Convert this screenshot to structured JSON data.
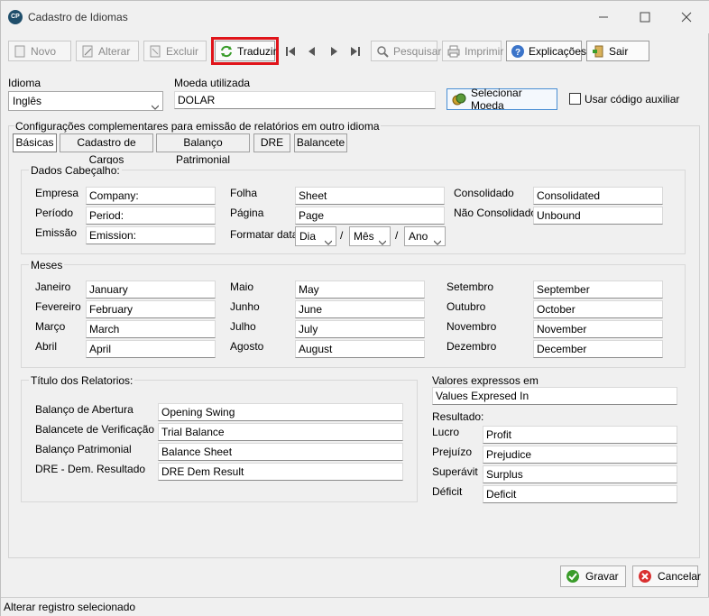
{
  "window": {
    "title": "Cadastro de Idiomas",
    "icon_text": "CP"
  },
  "toolbar": {
    "novo": "Novo",
    "alterar": "Alterar",
    "excluir": "Excluir",
    "traduzir": "Traduzir",
    "pesquisar": "Pesquisar",
    "imprimir": "Imprimir",
    "explicacoes": "Explicações",
    "sair": "Sair"
  },
  "form": {
    "idioma_label": "Idioma",
    "idioma_value": "Inglês",
    "moeda_label": "Moeda utilizada",
    "moeda_value": "DOLAR",
    "selecionar_moeda": "Selecionar Moeda",
    "usar_codigo": "Usar código auxiliar"
  },
  "config_title": "Configurações complementares para emissão de relatórios em outro idioma",
  "tabs": [
    "Básicas",
    "Cadastro de Cargos",
    "Balanço Patrimonial",
    "DRE",
    "Balancete"
  ],
  "cabecalho": {
    "title": "Dados Cabeçalho:",
    "empresa_label": "Empresa",
    "empresa_value": "Company:",
    "periodo_label": "Período",
    "periodo_value": "Period:",
    "emissao_label": "Emissão",
    "emissao_value": "Emission:",
    "folha_label": "Folha",
    "folha_value": "Sheet",
    "pagina_label": "Página",
    "pagina_value": "Page",
    "formatar_label": "Formatar data",
    "dia": "Dia",
    "mes": "Mês",
    "ano": "Ano",
    "sep": "/",
    "consolidado_label": "Consolidado",
    "consolidado_value": "Consolidated",
    "nao_consolidado_label": "Não Consolidado",
    "nao_consolidado_value": "Unbound"
  },
  "meses": {
    "title": "Meses",
    "items": [
      {
        "label": "Janeiro",
        "value": "January"
      },
      {
        "label": "Fevereiro",
        "value": "February"
      },
      {
        "label": "Março",
        "value": "March"
      },
      {
        "label": "Abril",
        "value": "April"
      },
      {
        "label": "Maio",
        "value": "May"
      },
      {
        "label": "Junho",
        "value": "June"
      },
      {
        "label": "Julho",
        "value": "July"
      },
      {
        "label": "Agosto",
        "value": "August"
      },
      {
        "label": "Setembro",
        "value": "September"
      },
      {
        "label": "Outubro",
        "value": "October"
      },
      {
        "label": "Novembro",
        "value": "November"
      },
      {
        "label": "Dezembro",
        "value": "December"
      }
    ]
  },
  "titulos": {
    "title": "Título dos Relatorios:",
    "items": [
      {
        "label": "Balanço de Abertura",
        "value": "Opening Swing"
      },
      {
        "label": "Balancete de Verificação",
        "value": "Trial Balance"
      },
      {
        "label": "Balanço Patrimonial",
        "value": "Balance Sheet"
      },
      {
        "label": "DRE - Dem. Resultado",
        "value": "DRE Dem Result"
      }
    ]
  },
  "valores": {
    "title": "Valores expressos em",
    "value": "Values Expresed In",
    "resultado_title": "Resultado:",
    "items": [
      {
        "label": "Lucro",
        "value": "Profit"
      },
      {
        "label": "Prejuízo",
        "value": "Prejudice"
      },
      {
        "label": "Superávit",
        "value": "Surplus"
      },
      {
        "label": "Déficit",
        "value": "Deficit"
      }
    ]
  },
  "footer": {
    "gravar": "Gravar",
    "cancelar": "Cancelar"
  },
  "status": "Alterar registro selecionado"
}
